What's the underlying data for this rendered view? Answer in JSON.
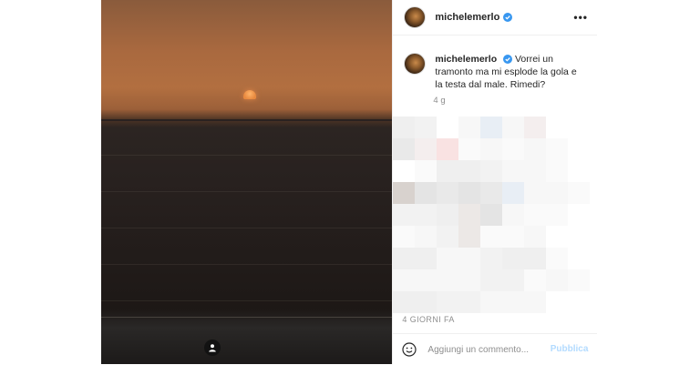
{
  "post": {
    "username": "michelemerlo",
    "verified": true,
    "more_icon": "more-horizontal-icon",
    "caption_text": "Vorrei un tramonto ma mi esplode la gola e la testa dal male. Rimedi?",
    "caption_time": "4 g",
    "posted_ago": "4 GIORNI FA",
    "comment_placeholder": "Aggiungi un commento...",
    "publish_label": "Pubblica",
    "user_tag_icon": "user-icon",
    "emoji_icon": "smiley-icon"
  },
  "colors": {
    "verified_blue": "#3897f0",
    "publish_disabled": "#b3dbff",
    "muted_text": "#8e8e8e"
  }
}
